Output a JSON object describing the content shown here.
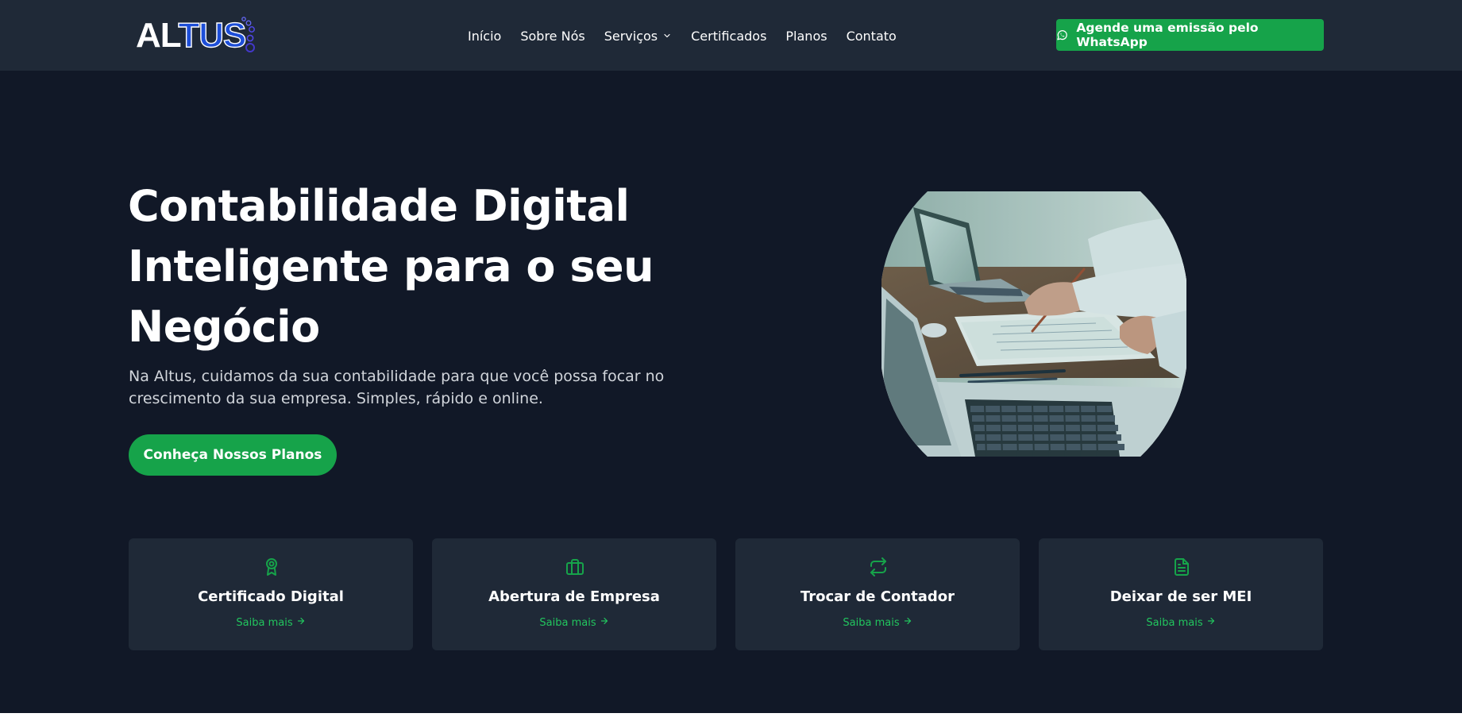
{
  "brand": {
    "logo_part1": "AL",
    "logo_part2": "TUS"
  },
  "nav": {
    "items": [
      {
        "label": "Início"
      },
      {
        "label": "Sobre Nós"
      },
      {
        "label": "Serviços"
      },
      {
        "label": "Certificados"
      },
      {
        "label": "Planos"
      },
      {
        "label": "Contato"
      }
    ]
  },
  "header": {
    "cta_label": "Agende uma emissão pelo WhatsApp",
    "cta_icon": "whatsapp-icon"
  },
  "hero": {
    "title_lines": [
      "Contabilidade Digital",
      "Inteligente para o seu",
      "Negócio"
    ],
    "subtitle_lines": [
      "Na Altus, cuidamos da sua contabilidade para que você possa focar no",
      "crescimento da sua empresa. Simples, rápido e online."
    ],
    "cta_label": "Conheça Nossos Planos"
  },
  "services": [
    {
      "title": "Certificado Digital",
      "link": "Saiba mais",
      "icon": "award-icon"
    },
    {
      "title": "Abertura de Empresa",
      "link": "Saiba mais",
      "icon": "briefcase-icon"
    },
    {
      "title": "Trocar de Contador",
      "link": "Saiba mais",
      "icon": "repeat-icon"
    },
    {
      "title": "Deixar de ser MEI",
      "link": "Saiba mais",
      "icon": "file-text-icon"
    }
  ],
  "colors": {
    "background": "#111827",
    "header": "#1f2937",
    "card": "#1f2937",
    "accent_green": "#16a34a",
    "link_green": "#22c55e",
    "logo_blue": "#1d4ed8"
  }
}
